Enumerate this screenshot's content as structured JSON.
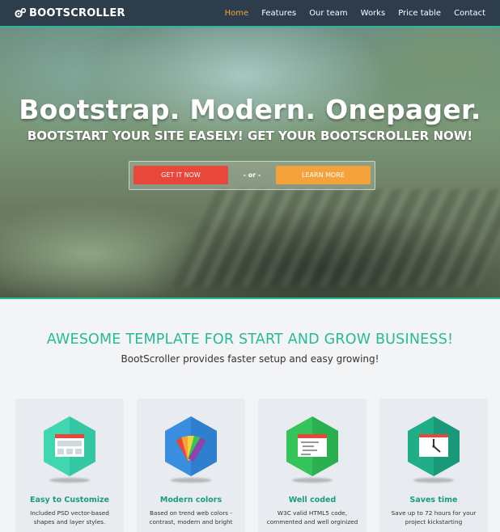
{
  "brand": {
    "name": "BOOTSCROLLER"
  },
  "nav": {
    "items": [
      {
        "label": "Home",
        "active": true
      },
      {
        "label": "Features"
      },
      {
        "label": "Our team"
      },
      {
        "label": "Works"
      },
      {
        "label": "Price table"
      },
      {
        "label": "Contact"
      }
    ]
  },
  "hero": {
    "title": "Bootstrap. Modern. Onepager.",
    "subtitle": "BOOTSTART YOUR SITE EASELY! GET YOUR BOOTSCROLLER NOW!",
    "primary_button": "GET IT NOW",
    "separator": "- or -",
    "secondary_button": "LEARN MORE"
  },
  "intro": {
    "title": "AWESOME TEMPLATE FOR START AND GROW BUSINESS!",
    "subtitle": "BootScroller provides faster setup and easy growing!"
  },
  "features": [
    {
      "title": "Easy to Customize",
      "desc": "Included PSD vector-based shapes and layer styles.",
      "icon": "layout-icon",
      "color": "#3fd6b0"
    },
    {
      "title": "Modern colors",
      "desc": "Based on trend web colors - contrast, modern and bright",
      "icon": "color-swatch-icon",
      "color": "#3a8ee0"
    },
    {
      "title": "Well coded",
      "desc": "W3C valid HTML5 code, commented and well orginized",
      "icon": "code-document-icon",
      "color": "#33c45a"
    },
    {
      "title": "Saves time",
      "desc": "Save up to 72 hours for your project kickstarting",
      "icon": "clock-icon",
      "color": "#1fae88"
    }
  ],
  "colors": {
    "accent": "#29b996",
    "navbar": "#2e3d4c",
    "cta_red": "#e8473a",
    "cta_orange": "#f5a23a"
  }
}
